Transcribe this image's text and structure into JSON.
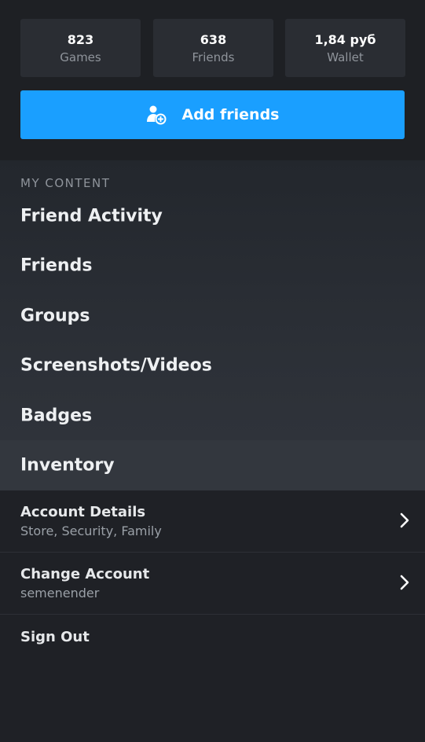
{
  "stats": [
    {
      "value": "823",
      "label": "Games"
    },
    {
      "value": "638",
      "label": "Friends"
    },
    {
      "value": "1,84 руб",
      "label": "Wallet"
    }
  ],
  "add_friends": {
    "label": "Add friends",
    "icon": "add-user-icon"
  },
  "my_content": {
    "header": "MY CONTENT",
    "items": [
      {
        "label": "Friend Activity"
      },
      {
        "label": "Friends"
      },
      {
        "label": "Groups"
      },
      {
        "label": "Screenshots/Videos"
      },
      {
        "label": "Badges"
      },
      {
        "label": "Inventory"
      }
    ]
  },
  "account": [
    {
      "title": "Account Details",
      "subtitle": "Store, Security, Family",
      "icon": "chevron-right-icon"
    },
    {
      "title": "Change Account",
      "subtitle": "semenender",
      "icon": "chevron-right-icon"
    }
  ],
  "sign_out": {
    "label": "Sign Out"
  },
  "colors": {
    "background": "#1f2126",
    "tile": "#2a2d33",
    "accent": "#1a9fff",
    "muted_text": "#8f949b"
  }
}
